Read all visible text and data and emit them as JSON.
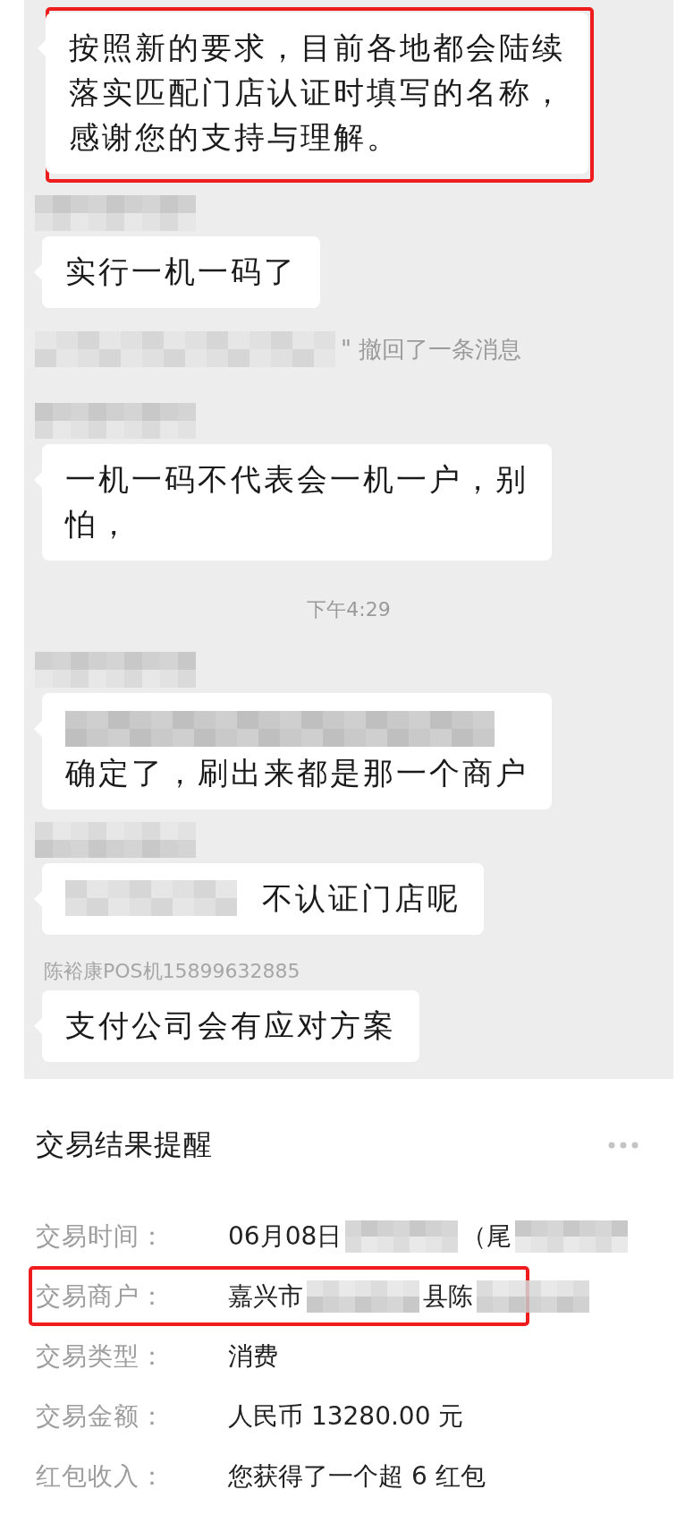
{
  "chat": {
    "messages": [
      {
        "kind": "bubble",
        "sender": {
          "kind": "none"
        },
        "highlighted": true,
        "body": [
          {
            "kind": "text",
            "text": "按照新的要求，目前各地都会陆续"
          },
          {
            "kind": "text",
            "text": "落实匹配门店认证时填写的名称，"
          },
          {
            "kind": "text",
            "text": "感谢您的支持与理解。"
          }
        ]
      },
      {
        "kind": "bubble",
        "sender": {
          "kind": "redacted"
        },
        "highlighted": false,
        "body": [
          {
            "kind": "text",
            "text": "实行一机一码了"
          }
        ]
      },
      {
        "kind": "recall",
        "text": "\" 撤回了一条消息"
      },
      {
        "kind": "bubble",
        "sender": {
          "kind": "redacted"
        },
        "highlighted": false,
        "body": [
          {
            "kind": "text",
            "text": "一机一码不代表会一机一户，别"
          },
          {
            "kind": "text",
            "text": "怕，"
          }
        ]
      },
      {
        "kind": "time",
        "text": "下午4:29"
      },
      {
        "kind": "bubble",
        "sender": {
          "kind": "redacted"
        },
        "highlighted": false,
        "body": [
          {
            "kind": "redacted_line"
          },
          {
            "kind": "text",
            "text": "确定了，刷出来都是那一个商户"
          }
        ]
      },
      {
        "kind": "bubble",
        "sender": {
          "kind": "redacted"
        },
        "highlighted": false,
        "body": [
          {
            "kind": "redacted_inline"
          },
          {
            "kind": "text",
            "text": "不认证门店呢"
          }
        ]
      },
      {
        "kind": "bubble",
        "sender": {
          "kind": "name",
          "text": "陈裕康POS机15899632885"
        },
        "highlighted": false,
        "body": [
          {
            "kind": "text",
            "text": "支付公司会有应对方案"
          }
        ]
      }
    ]
  },
  "notice": {
    "title": "交易结果提醒",
    "rows": [
      {
        "label": "交易时间：",
        "highlighted": false,
        "value": [
          {
            "kind": "text",
            "text": "06月08日"
          },
          {
            "kind": "redacted"
          },
          {
            "kind": "text",
            "text": "（尾"
          },
          {
            "kind": "redacted"
          }
        ]
      },
      {
        "label": "交易商户：",
        "highlighted": true,
        "value": [
          {
            "kind": "text",
            "text": "嘉兴市"
          },
          {
            "kind": "redacted"
          },
          {
            "kind": "text",
            "text": "县陈"
          },
          {
            "kind": "redacted"
          }
        ]
      },
      {
        "label": "交易类型：",
        "highlighted": false,
        "value": [
          {
            "kind": "text",
            "text": "消费"
          }
        ]
      },
      {
        "label": "交易金额：",
        "highlighted": false,
        "value": [
          {
            "kind": "text",
            "text": "人民币 13280.00 元"
          }
        ]
      },
      {
        "label": "红包收入：",
        "highlighted": false,
        "value": [
          {
            "kind": "text",
            "text": "您获得了一个超 6 红包"
          }
        ]
      }
    ]
  }
}
